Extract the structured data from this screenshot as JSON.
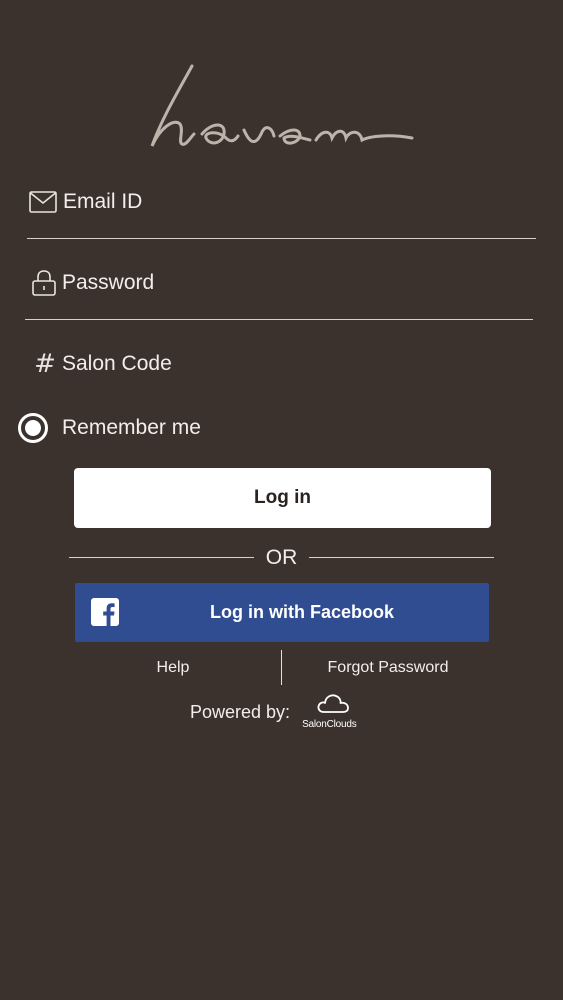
{
  "logo": {
    "text": "haven"
  },
  "email": {
    "placeholder": "Email ID",
    "icon": "mail-icon"
  },
  "password": {
    "placeholder": "Password",
    "icon": "lock-icon"
  },
  "salon_code": {
    "placeholder": "Salon Code",
    "icon": "hash-icon"
  },
  "remember": {
    "label": "Remember me",
    "checked": true
  },
  "login_button": {
    "label": "Log in"
  },
  "divider": {
    "label": "OR"
  },
  "facebook_button": {
    "label": "Log in with Facebook",
    "icon": "facebook-icon",
    "color": "#2f4d90"
  },
  "links": {
    "help": "Help",
    "forgot": "Forgot Password"
  },
  "footer": {
    "powered_by": "Powered by:",
    "brand": "SalonClouds"
  },
  "colors": {
    "background": "#3b322d",
    "text": "#f3eeea"
  }
}
